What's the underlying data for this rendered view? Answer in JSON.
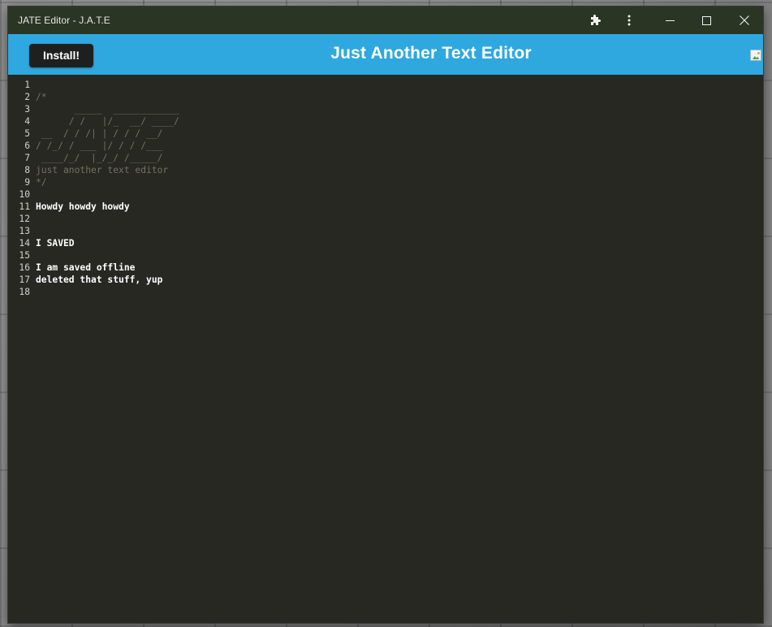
{
  "window": {
    "title": "JATE Editor - J.A.T.E",
    "icons": {
      "extensions": "puzzle-icon",
      "menu": "more-vertical-icon",
      "minimize": "minimize-icon",
      "maximize": "maximize-icon",
      "close": "close-icon"
    }
  },
  "header": {
    "install_label": "Install!",
    "title": "Just Another Text Editor",
    "logo_icon": "broken-image-icon",
    "background_color": "#2ea8df"
  },
  "editor": {
    "background_color": "#272822",
    "comment_color": "#75715e",
    "lines": [
      {
        "num": "1",
        "text": "",
        "kind": "text"
      },
      {
        "num": "2",
        "text": "/*",
        "kind": "comment"
      },
      {
        "num": "3",
        "text": "       _____  ____________",
        "kind": "comment"
      },
      {
        "num": "4",
        "text": "      / /   |/_  __/ ____/",
        "kind": "comment"
      },
      {
        "num": "5",
        "text": " __  / / /| | / / / __/",
        "kind": "comment"
      },
      {
        "num": "6",
        "text": "/ /_/ / ___ |/ / / /___",
        "kind": "comment"
      },
      {
        "num": "7",
        "text": " ____/_/  |_/_/ /_____/",
        "kind": "comment"
      },
      {
        "num": "8",
        "text": "just another text editor",
        "kind": "comment"
      },
      {
        "num": "9",
        "text": "*/",
        "kind": "comment"
      },
      {
        "num": "10",
        "text": "",
        "kind": "text"
      },
      {
        "num": "11",
        "text": "Howdy howdy howdy",
        "kind": "text"
      },
      {
        "num": "12",
        "text": "",
        "kind": "text"
      },
      {
        "num": "13",
        "text": "",
        "kind": "text"
      },
      {
        "num": "14",
        "text": "I SAVED",
        "kind": "text"
      },
      {
        "num": "15",
        "text": "",
        "kind": "text"
      },
      {
        "num": "16",
        "text": "I am saved offline",
        "kind": "text"
      },
      {
        "num": "17",
        "text": "deleted that stuff, yup",
        "kind": "text"
      },
      {
        "num": "18",
        "text": "",
        "kind": "text"
      }
    ]
  }
}
